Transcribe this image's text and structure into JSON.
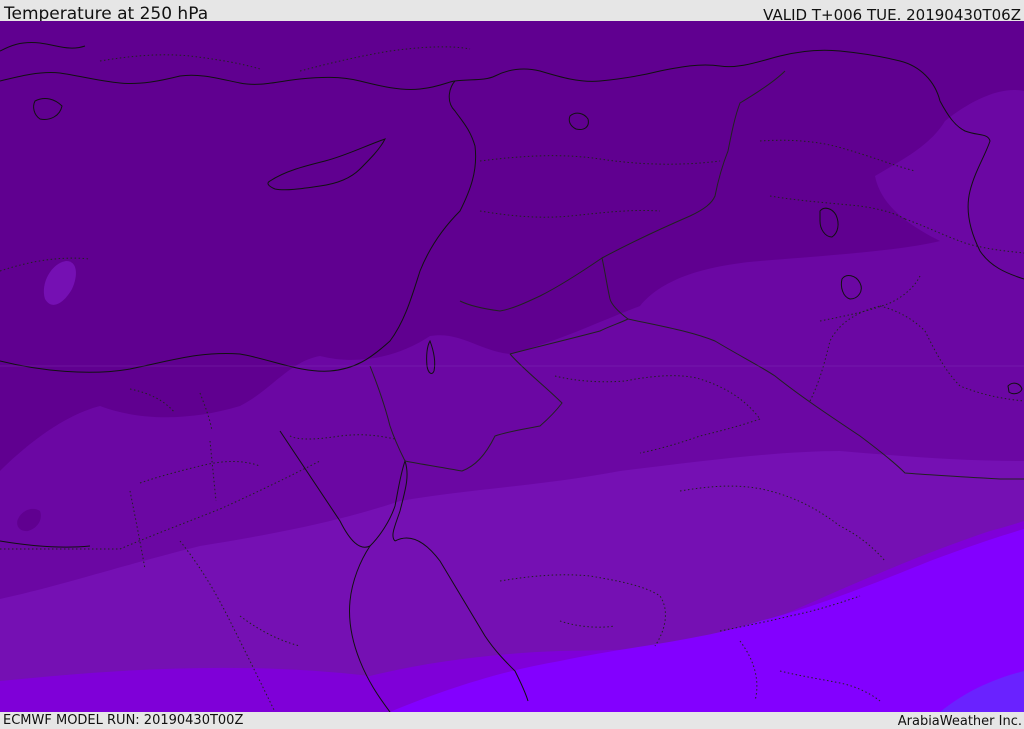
{
  "header": {
    "title": "Temperature at 250 hPa",
    "valid_time": "VALID T+006 TUE. 20190430T06Z"
  },
  "footer": {
    "model_run": "ECMWF MODEL RUN: 20190430T00Z",
    "credit": "ArabiaWeather Inc."
  },
  "map": {
    "field": "temperature",
    "level": "250 hPa",
    "colors": {
      "band_darkest": "#600090",
      "band_dark": "#6b07a3",
      "band_mid": "#7510b3",
      "band_bright": "#7f00d8",
      "band_brightest": "#8300ff",
      "band_corner": "#6a22ff",
      "coastline": "#111111",
      "border": "#222222"
    }
  }
}
